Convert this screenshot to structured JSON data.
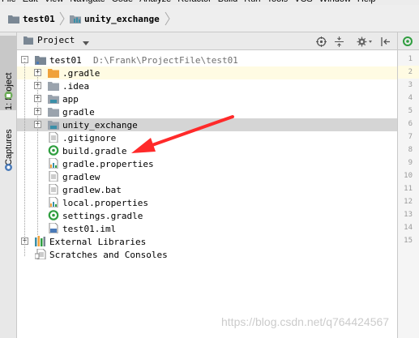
{
  "menu": {
    "items": [
      "File",
      "Edit",
      "View",
      "Navigate",
      "Code",
      "Analyze",
      "Refactor",
      "Build",
      "Run",
      "Tools",
      "VCS",
      "Window",
      "Help"
    ]
  },
  "breadcrumb": {
    "items": [
      {
        "label": "test01"
      },
      {
        "label": "unity_exchange"
      }
    ]
  },
  "toolstrip": {
    "project_tab": "1: Project",
    "captures_tab": "Captures"
  },
  "panel": {
    "title": "Project",
    "dropdown_icon": "chevron-down-icon",
    "tools": [
      "locate-icon",
      "collapse-all-icon",
      "gear-icon",
      "hide-icon"
    ]
  },
  "tree": {
    "root": {
      "label": "test01",
      "path": "D:\\Frank\\ProjectFile\\test01"
    },
    "children": [
      {
        "label": ".gradle",
        "icon": "folder-orange-icon",
        "expandable": true
      },
      {
        "label": ".idea",
        "icon": "folder-icon",
        "expandable": true
      },
      {
        "label": "app",
        "icon": "module-folder-icon",
        "expandable": true
      },
      {
        "label": "gradle",
        "icon": "folder-icon",
        "expandable": true
      },
      {
        "label": "unity_exchange",
        "icon": "module-folder-icon",
        "expandable": true,
        "selected": true
      },
      {
        "label": ".gitignore",
        "icon": "text-file-icon",
        "expandable": false
      },
      {
        "label": "build.gradle",
        "icon": "gradle-icon",
        "expandable": false
      },
      {
        "label": "gradle.properties",
        "icon": "properties-file-icon",
        "expandable": false
      },
      {
        "label": "gradlew",
        "icon": "text-file-icon",
        "expandable": false
      },
      {
        "label": "gradlew.bat",
        "icon": "text-file-icon",
        "expandable": false
      },
      {
        "label": "local.properties",
        "icon": "properties-file-icon",
        "expandable": false
      },
      {
        "label": "settings.gradle",
        "icon": "gradle-icon",
        "expandable": false
      },
      {
        "label": "test01.iml",
        "icon": "iml-file-icon",
        "expandable": false
      }
    ],
    "external_libraries": "External Libraries",
    "scratches": "Scratches and Consoles"
  },
  "gutter": {
    "line_numbers": [
      "1",
      "2",
      "3",
      "4",
      "5",
      "6",
      "7",
      "8",
      "9",
      "10",
      "11",
      "12",
      "13",
      "14",
      "15"
    ]
  },
  "watermark": "https://blog.csdn.net/q764424567",
  "colors": {
    "selection": "#d5d5d5",
    "highlight": "#fffbe3",
    "arrow": "#ff2a2a",
    "gradle_green": "#2f9e3f",
    "folder_orange": "#f0a23a",
    "folder_gray": "#9aa3ad",
    "module_teal": "#3a8fa8"
  }
}
